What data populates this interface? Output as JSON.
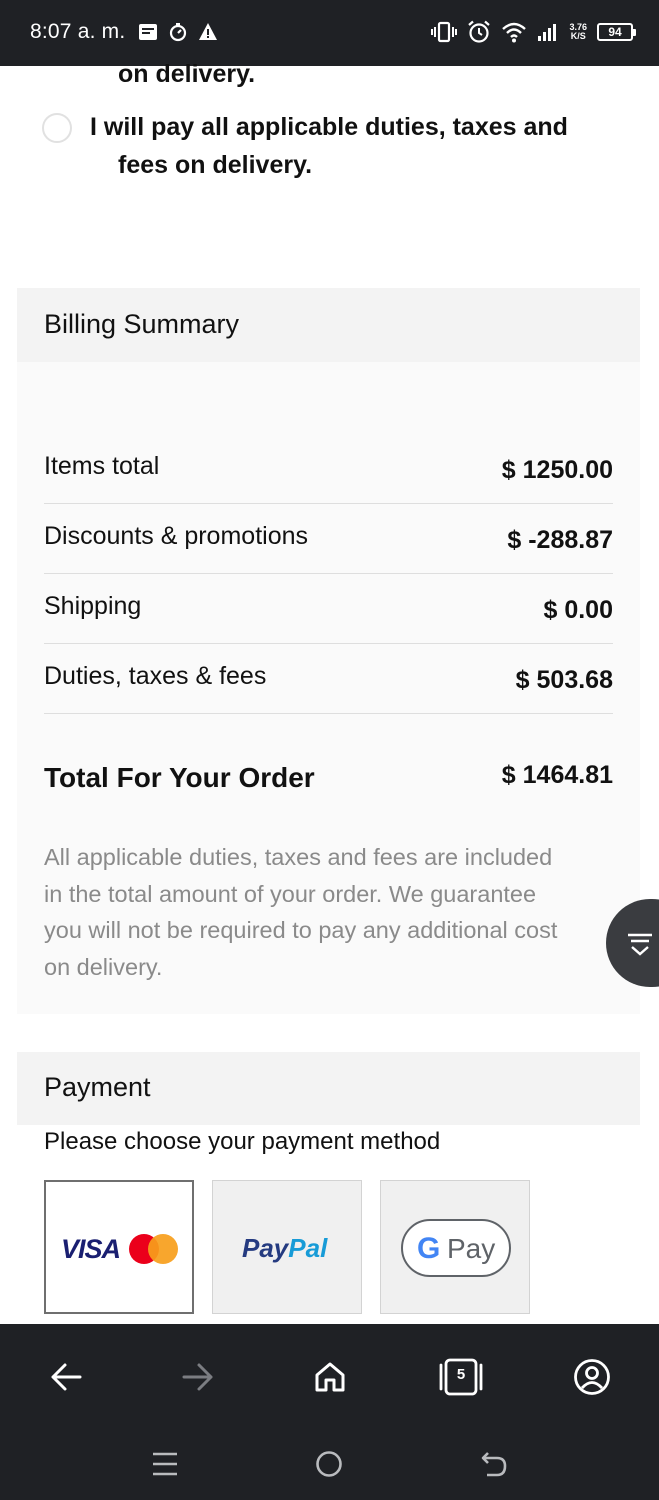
{
  "status_bar": {
    "time": "8:07 a. m.",
    "net_speed_value": "3.76",
    "net_speed_unit": "K/S",
    "battery": "94"
  },
  "duties": {
    "previous_option_fragment": "on delivery.",
    "option_line1": "I will pay all applicable duties, taxes and",
    "option_line2": "fees on delivery."
  },
  "billing": {
    "title": "Billing Summary",
    "rows": [
      {
        "label": "Items total",
        "value": "$ 1250.00"
      },
      {
        "label": "Discounts & promotions",
        "value": "$ -288.87"
      },
      {
        "label": "Shipping",
        "value": "$ 0.00"
      },
      {
        "label": "Duties, taxes & fees",
        "value": "$ 503.68"
      }
    ],
    "total_label": "Total For Your Order",
    "total_value": "$ 1464.81",
    "note_lines": [
      "All applicable duties, taxes and fees are included",
      "in the total amount of your order. We guarantee",
      "you will not be required to pay any additional cost",
      "on delivery."
    ]
  },
  "payment": {
    "title": "Payment",
    "prompt": "Please choose your payment method",
    "methods": [
      {
        "name": "visa-mastercard",
        "label": "VISA",
        "selected": true
      },
      {
        "name": "paypal",
        "label_a": "Pay",
        "label_b": "Pal",
        "selected": false
      },
      {
        "name": "google-pay",
        "label_g": "G",
        "label_pay": "Pay",
        "selected": false
      }
    ]
  },
  "browser_nav": {
    "tab_count": "5"
  },
  "colors": {
    "visa_blue": "#1a1f71",
    "mastercard_red": "#eb001b",
    "mastercard_orange": "#f79e1b",
    "paypal_dark": "#253b80",
    "paypal_light": "#179bd7",
    "google_blue": "#4285f4",
    "dark_bar": "#1f2125"
  }
}
